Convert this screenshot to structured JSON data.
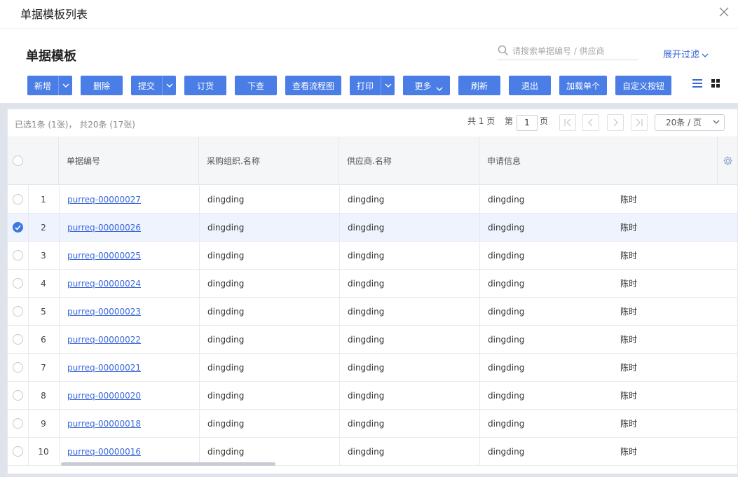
{
  "window": {
    "title": "单据模板列表"
  },
  "header": {
    "heading": "单据模板",
    "search_placeholder": "请搜索单据编号 / 供应商",
    "expand_filter": "展开过滤"
  },
  "toolbar": {
    "new": "新增",
    "delete": "删除",
    "submit": "提交",
    "order": "订货",
    "push_down": "下查",
    "view_flow": "查看流程图",
    "print": "打印",
    "more": "更多",
    "refresh": "刷新",
    "exit": "退出",
    "load_single": "加载单个",
    "custom_button": "自定义按钮"
  },
  "grid": {
    "selection_info": "已选1条 (1张)， 共20条 (17张)",
    "pager": {
      "total_pages_label": "共 1 页",
      "page_prefix": "第",
      "current_page": "1",
      "page_suffix": "页",
      "page_size": "20条 / 页"
    },
    "columns": [
      "单据编号",
      "采购组织.名称",
      "供应商.名称",
      "申请信息"
    ],
    "rows": [
      {
        "num": "1",
        "code": "purreq-00000027",
        "org": "dingding",
        "supplier": "dingding",
        "info": "dingding",
        "person": "陈时",
        "selected": false
      },
      {
        "num": "2",
        "code": "purreq-00000026",
        "org": "dingding",
        "supplier": "dingding",
        "info": "dingding",
        "person": "陈时",
        "selected": true
      },
      {
        "num": "3",
        "code": "purreq-00000025",
        "org": "dingding",
        "supplier": "dingding",
        "info": "dingding",
        "person": "陈时",
        "selected": false
      },
      {
        "num": "4",
        "code": "purreq-00000024",
        "org": "dingding",
        "supplier": "dingding",
        "info": "dingding",
        "person": "陈时",
        "selected": false
      },
      {
        "num": "5",
        "code": "purreq-00000023",
        "org": "dingding",
        "supplier": "dingding",
        "info": "dingding",
        "person": "陈时",
        "selected": false
      },
      {
        "num": "6",
        "code": "purreq-00000022",
        "org": "dingding",
        "supplier": "dingding",
        "info": "dingding",
        "person": "陈时",
        "selected": false
      },
      {
        "num": "7",
        "code": "purreq-00000021",
        "org": "dingding",
        "supplier": "dingding",
        "info": "dingding",
        "person": "陈时",
        "selected": false
      },
      {
        "num": "8",
        "code": "purreq-00000020",
        "org": "dingding",
        "supplier": "dingding",
        "info": "dingding",
        "person": "陈时",
        "selected": false
      },
      {
        "num": "9",
        "code": "purreq-00000018",
        "org": "dingding",
        "supplier": "dingding",
        "info": "dingding",
        "person": "陈时",
        "selected": false
      },
      {
        "num": "10",
        "code": "purreq-00000016",
        "org": "dingding",
        "supplier": "dingding",
        "info": "dingding",
        "person": "陈时",
        "selected": false
      }
    ]
  },
  "colors": {
    "accent": "#4a7ee6",
    "link": "#3a67d9",
    "selected_row": "#eef3fd"
  },
  "icons": [
    "close-icon",
    "search-icon",
    "chevron-down-icon",
    "list-view-icon",
    "grid-view-icon",
    "first-page-icon",
    "prev-page-icon",
    "next-page-icon",
    "last-page-icon",
    "gear-icon",
    "check-icon"
  ]
}
